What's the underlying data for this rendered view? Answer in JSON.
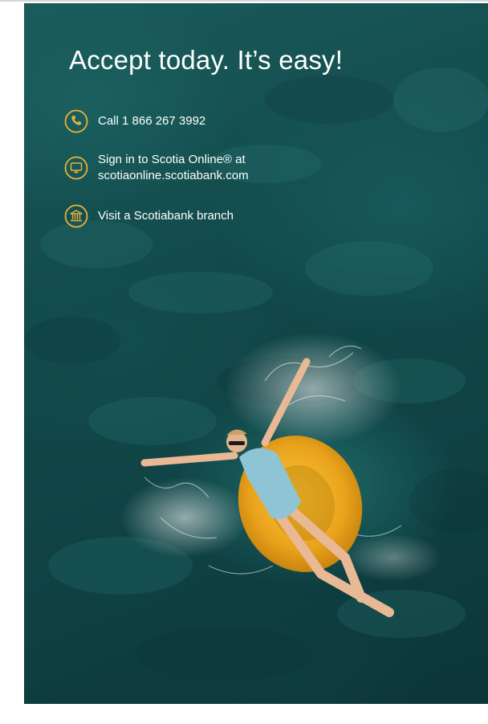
{
  "headline": "Accept today. It’s easy!",
  "accent_color": "#e8b23a",
  "contacts": [
    {
      "icon": "phone-icon",
      "lines": [
        "Call 1 866 267 3992"
      ]
    },
    {
      "icon": "computer-monitor-icon",
      "lines": [
        "Sign in to Scotia Online® at",
        "scotiaonline.scotiabank.com"
      ]
    },
    {
      "icon": "bank-branch-icon",
      "lines": [
        "Visit a Scotiabank branch"
      ]
    }
  ],
  "image": {
    "subject": "aerial-photo-woman-floating-on-yellow-inner-tube"
  }
}
